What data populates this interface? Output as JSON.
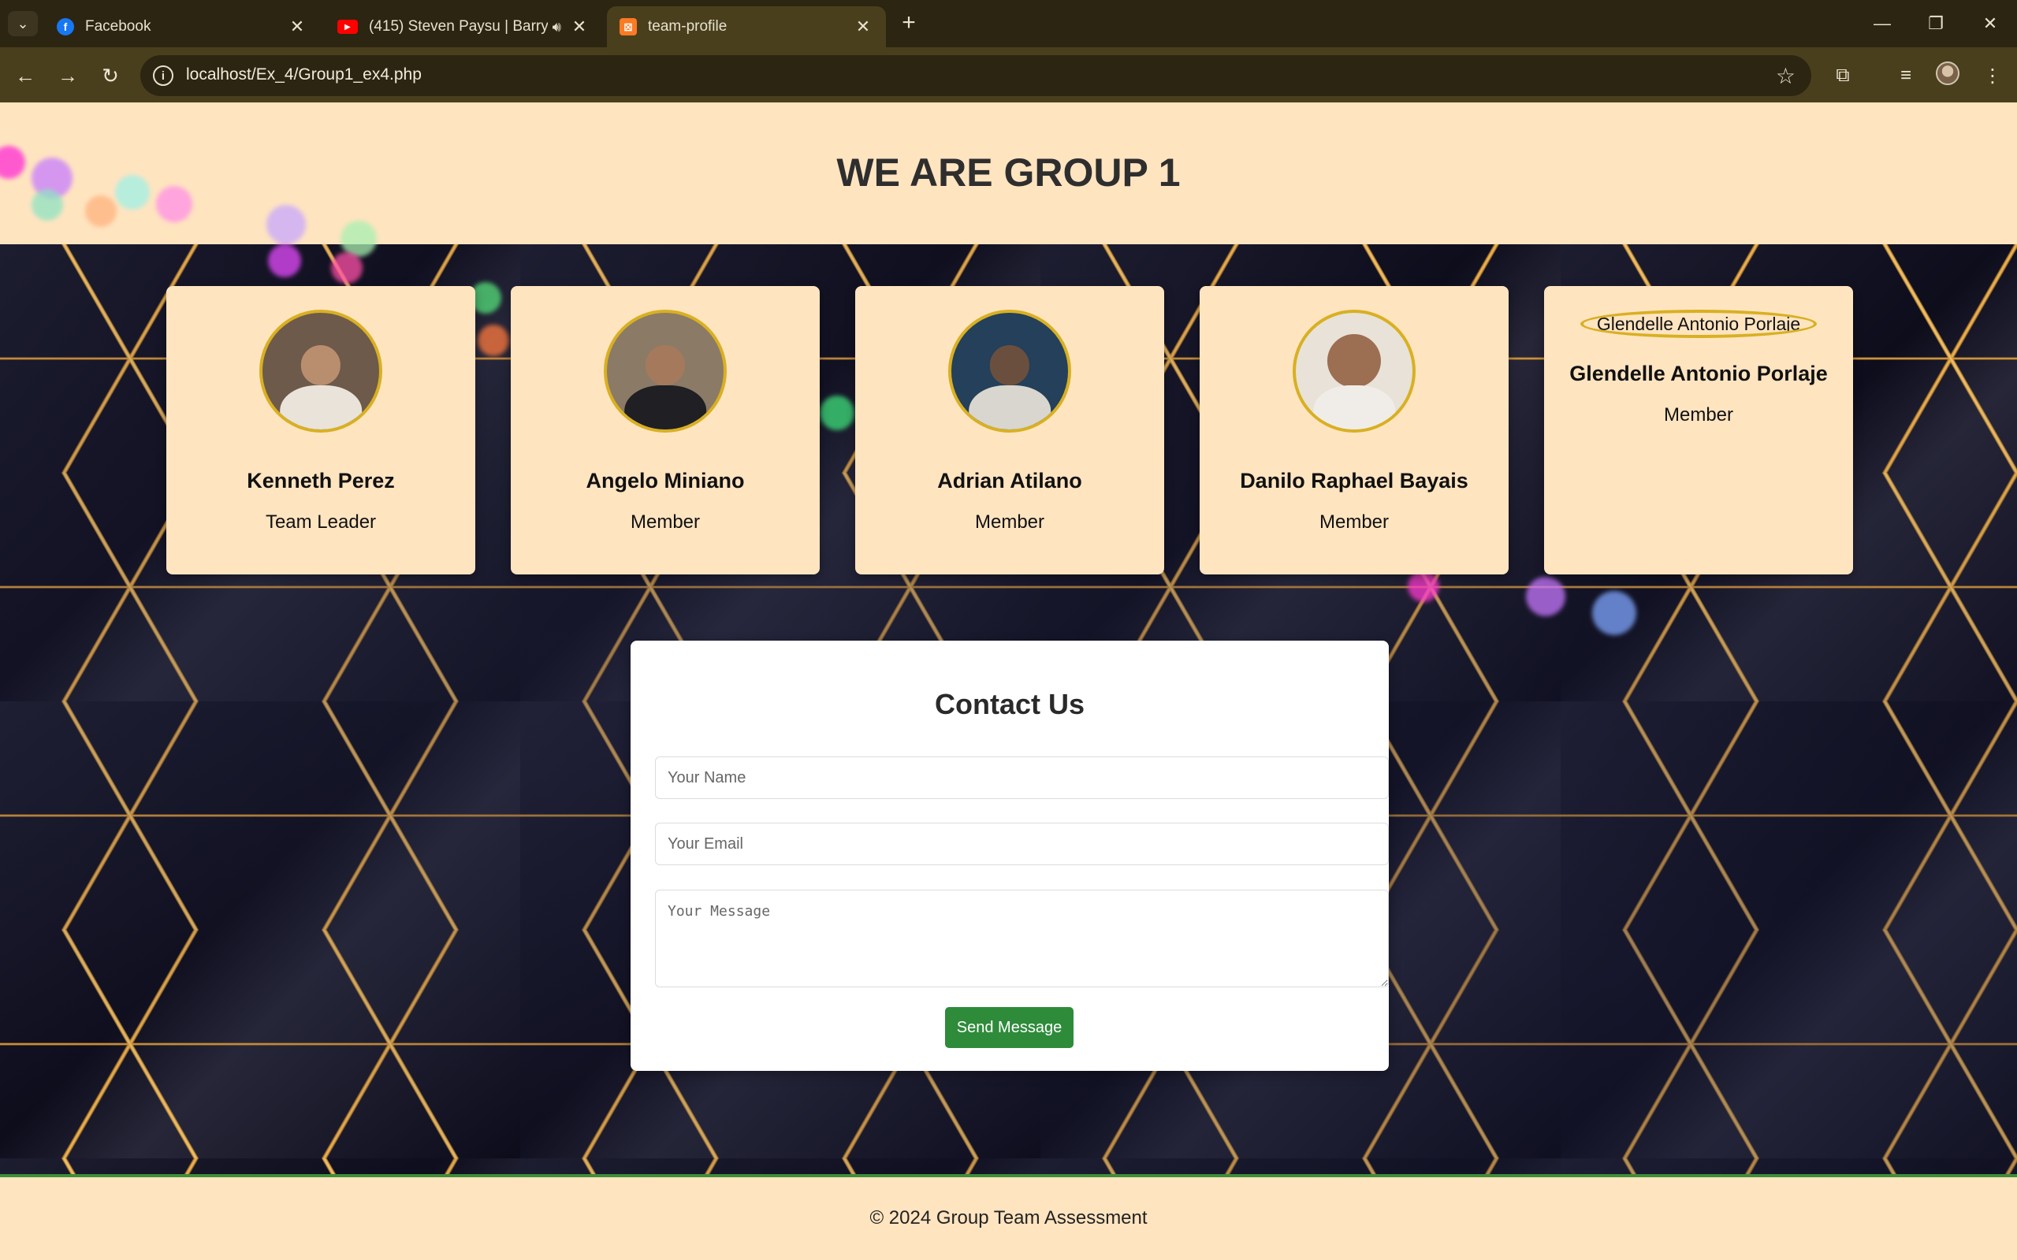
{
  "browser": {
    "tabs": [
      {
        "title": "Facebook",
        "favicon": "facebook-icon"
      },
      {
        "title": "(415) Steven Paysu | Barry M",
        "favicon": "youtube-icon",
        "audio": true
      },
      {
        "title": "team-profile",
        "favicon": "xampp-icon",
        "active": true
      }
    ],
    "url": "localhost/Ex_4/Group1_ex4.php"
  },
  "header": {
    "title": "WE ARE GROUP 1"
  },
  "members": [
    {
      "name": "Kenneth Perez",
      "role": "Team Leader"
    },
    {
      "name": "Angelo Miniano",
      "role": "Member"
    },
    {
      "name": "Adrian Atilano",
      "role": "Member"
    },
    {
      "name": "Danilo Raphael Bayais",
      "role": "Member"
    },
    {
      "name": "Glendelle Antonio Porlaje",
      "role": "Member",
      "image_alt": "Glendelle Antonio Porlaje"
    }
  ],
  "contact": {
    "title": "Contact Us",
    "name_placeholder": "Your Name",
    "email_placeholder": "Your Email",
    "message_placeholder": "Your Message",
    "send_label": "Send Message"
  },
  "footer": {
    "text": "© 2024 Group Team Assessment"
  },
  "colors": {
    "accent": "#2e8b3a",
    "card_bg": "#ffe4c0",
    "photo_border": "#d8b022"
  }
}
